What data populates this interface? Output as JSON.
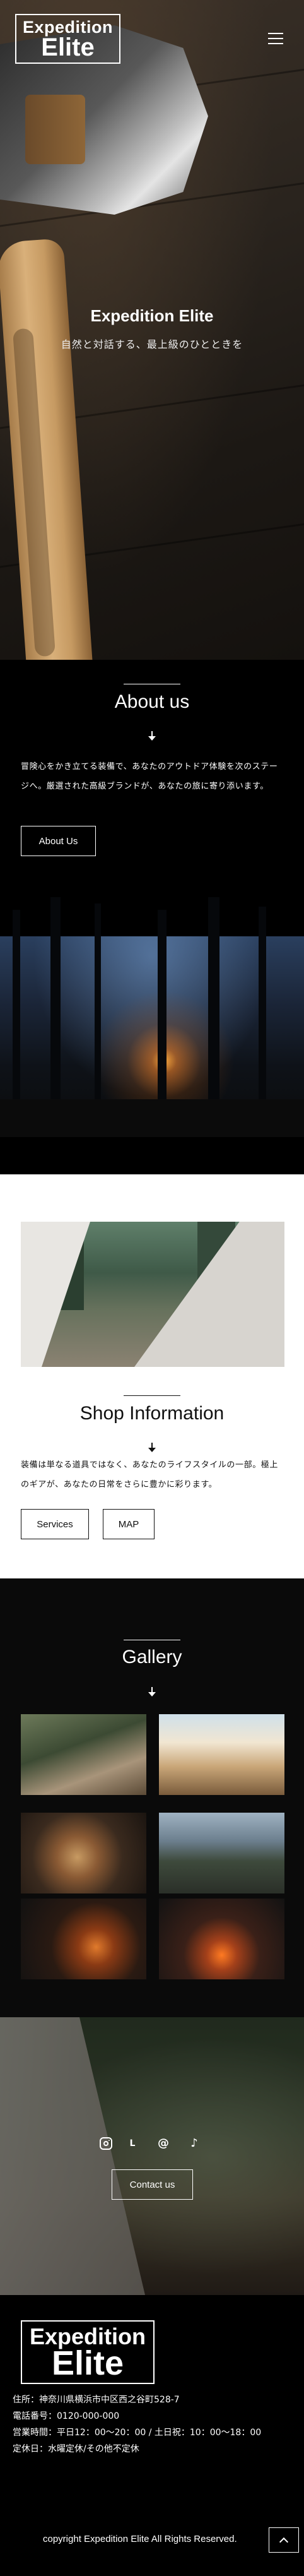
{
  "header": {
    "logo_line1": "Expedition",
    "logo_line2": "Elite",
    "menu_icon": "hamburger-icon"
  },
  "hero": {
    "title": "Expedition Elite",
    "subtitle": "自然と対話する、最上級のひとときを"
  },
  "about": {
    "title": "About us",
    "arrow_icon": "arrow-down-icon",
    "text": "冒険心をかき立てる装備で、あなたのアウトドア体験を次のステージへ。厳選された高級ブランドが、あなたの旅に寄り添います。",
    "button_label": "About Us"
  },
  "shop": {
    "title": "Shop Information",
    "arrow_icon": "arrow-down-icon",
    "text": "装備は単なる道具ではなく、あなたのライフスタイルの一部。極上のギアが、あなたの日常をさらに豊かに彩ります。",
    "services_label": "Services",
    "map_label": "MAP"
  },
  "gallery": {
    "title": "Gallery",
    "arrow_icon": "arrow-down-icon"
  },
  "contact": {
    "sns_icons": [
      "instagram-icon",
      "line-icon",
      "threads-icon",
      "tiktok-icon"
    ],
    "button_label": "Contact us"
  },
  "footer": {
    "logo_line1": "Expedition",
    "logo_line2": "Elite",
    "address": "住所：神奈川県横浜市中区西之谷町528-7",
    "phone": "電話番号：0120-000-000",
    "hours": "営業時間：平日12：00〜20：00 / 土日祝：10：00〜18：00",
    "closed": "定休日：水曜定休/その他不定休",
    "copyright": "copyright Expedition Elite All Rights Reserved.",
    "totop_icon": "chevron-up-icon"
  }
}
